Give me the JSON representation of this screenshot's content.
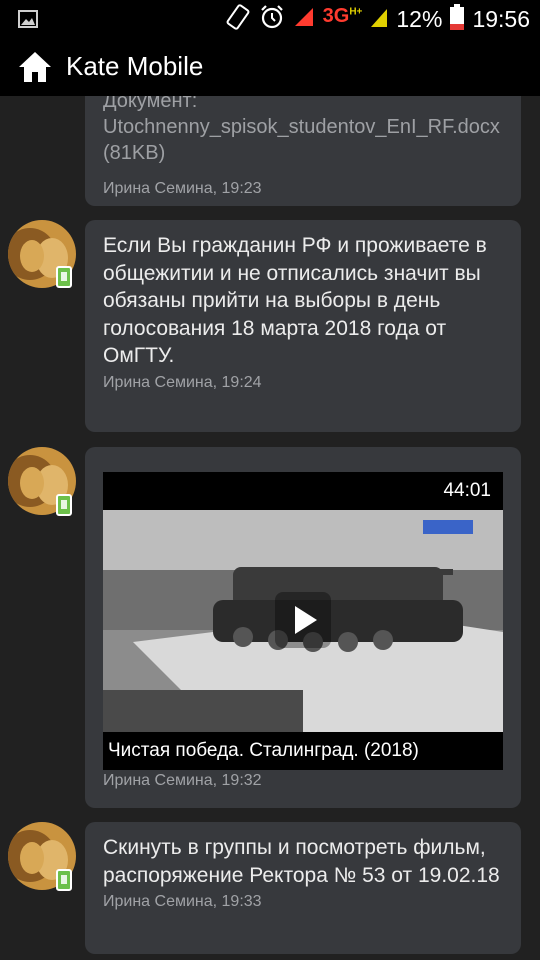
{
  "status_bar": {
    "network": "3G",
    "network_sup": "H+",
    "battery_percent": "12%",
    "time": "19:56"
  },
  "toolbar": {
    "title": "Kate Mobile"
  },
  "messages": [
    {
      "doc_label": "Документ:",
      "doc_name": "Utochnenny_spisok_studentov_EnI_RF.docx (81KB)",
      "meta": "Ирина Семина, 19:23"
    },
    {
      "text": "Если Вы гражданин РФ и проживаете в общежитии и не отписались значит вы обязаны прийти на выборы в день голосования 18 марта 2018 года от ОмГТУ.",
      "meta": "Ирина Семина, 19:24"
    },
    {
      "video": {
        "duration": "44:01",
        "title": "Чистая победа. Сталинград. (2018)"
      },
      "meta": "Ирина Семина, 19:32"
    },
    {
      "text": "Скинуть в группы и посмотреть фильм, распоряжение Ректора № 53 от 19.02.18",
      "meta": "Ирина Семина, 19:33"
    }
  ],
  "colors": {
    "background": "#212121",
    "bubble": "#37393d",
    "bar": "#000000",
    "meta_text": "#a0a2a6",
    "badge": "#6cc04a"
  }
}
